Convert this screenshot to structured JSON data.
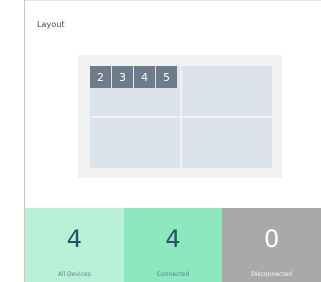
{
  "layout": {
    "title": "Layout",
    "preview": {
      "tabs": [
        "2",
        "3",
        "4",
        "5"
      ]
    }
  },
  "stats": [
    {
      "value": "4",
      "label": "All Devices",
      "background": "#b8efd7",
      "valueColor": "#2a4f6a",
      "labelColor": "#607a8b"
    },
    {
      "value": "4",
      "label": "Connected",
      "background": "#8ce8bf",
      "valueColor": "#2a4f6a",
      "labelColor": "#607a8b"
    },
    {
      "value": "0",
      "label": "Disconnected",
      "background": "#a9a9a9",
      "valueColor": "#ffffff",
      "labelColor": "#ffffff"
    }
  ]
}
